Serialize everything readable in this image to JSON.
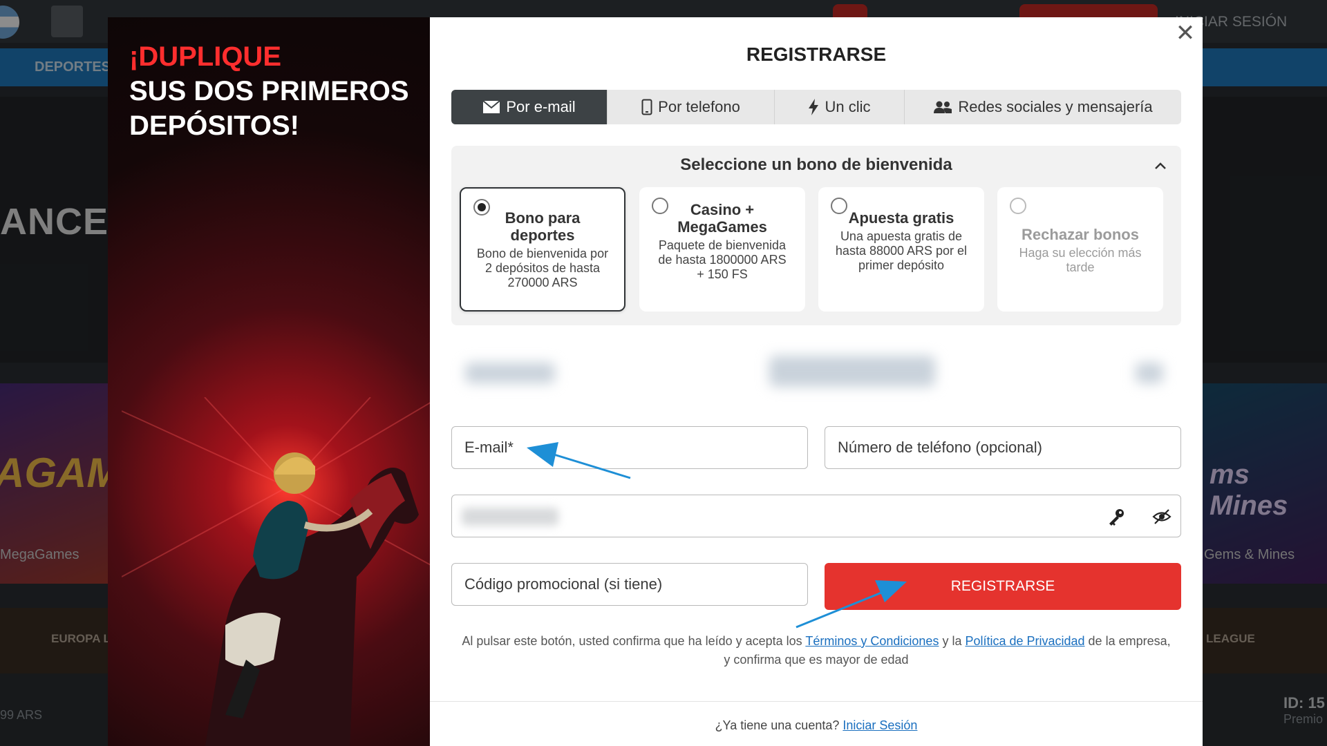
{
  "background": {
    "nav_item": "DEPORTES",
    "hero_text": "ANCE.",
    "left_game": "MegaGames",
    "left_game_art": "AGAM",
    "right_game": "Gems & Mines",
    "right_game_art": "ms Mines",
    "league_left": "EUROPA LEA",
    "league_right": "LEAGUE",
    "amount_left": "99 ARS",
    "id_right": "ID: 15",
    "premio_right": "Premio",
    "login_label": "INICIAR SESIÓN"
  },
  "promo": {
    "line1": "¡DUPLIQUE",
    "line2": "SUS DOS PRIMEROS",
    "line3": "DEPÓSITOS!"
  },
  "modal": {
    "title": "REGISTRARSE",
    "close_glyph": "✕",
    "tabs": [
      {
        "label": "Por e-mail",
        "icon": "envelope-icon",
        "active": true
      },
      {
        "label": "Por telefono",
        "icon": "phone-icon",
        "active": false
      },
      {
        "label": "Un clic",
        "icon": "lightning-icon",
        "active": false
      },
      {
        "label": "Redes sociales y mensajería",
        "icon": "users-icon",
        "active": false
      }
    ],
    "bonus": {
      "heading": "Seleccione un bono de bienvenida",
      "options": [
        {
          "title": "Bono para deportes",
          "desc": "Bono de bienvenida por 2 depósitos de hasta 270000 ARS",
          "selected": true
        },
        {
          "title": "Casino + MegaGames",
          "desc": "Paquete de bienvenida de hasta 1800000 ARS + 150 FS",
          "selected": false
        },
        {
          "title": "Apuesta gratis",
          "desc": "Una apuesta gratis de hasta 88000 ARS por el primer depósito",
          "selected": false
        },
        {
          "title": "Rechazar bonos",
          "desc": "Haga su elección más tarde",
          "selected": false
        }
      ]
    },
    "fields": {
      "email_placeholder": "E-mail*",
      "phone_placeholder": "Número de teléfono (opcional)",
      "promo_placeholder": "Código promocional (si tiene)"
    },
    "submit_label": "REGISTRARSE",
    "terms": {
      "prefix": "Al pulsar este botón, usted confirma que ha leído y acepta los ",
      "terms_link": "Términos y Condiciones",
      "middle": " y la ",
      "privacy_link": "Política de Privacidad",
      "suffix": " de la empresa,",
      "line2": "y confirma que es mayor de edad"
    },
    "login": {
      "prompt": "¿Ya tiene una cuenta? ",
      "link": "Iniciar Sesión"
    }
  },
  "colors": {
    "accent_red": "#e5332e",
    "promo_red": "#ff2e2e",
    "tab_active": "#3d4245",
    "link_blue": "#1a6fbf",
    "annotation_arrow": "#1e8fd6"
  }
}
